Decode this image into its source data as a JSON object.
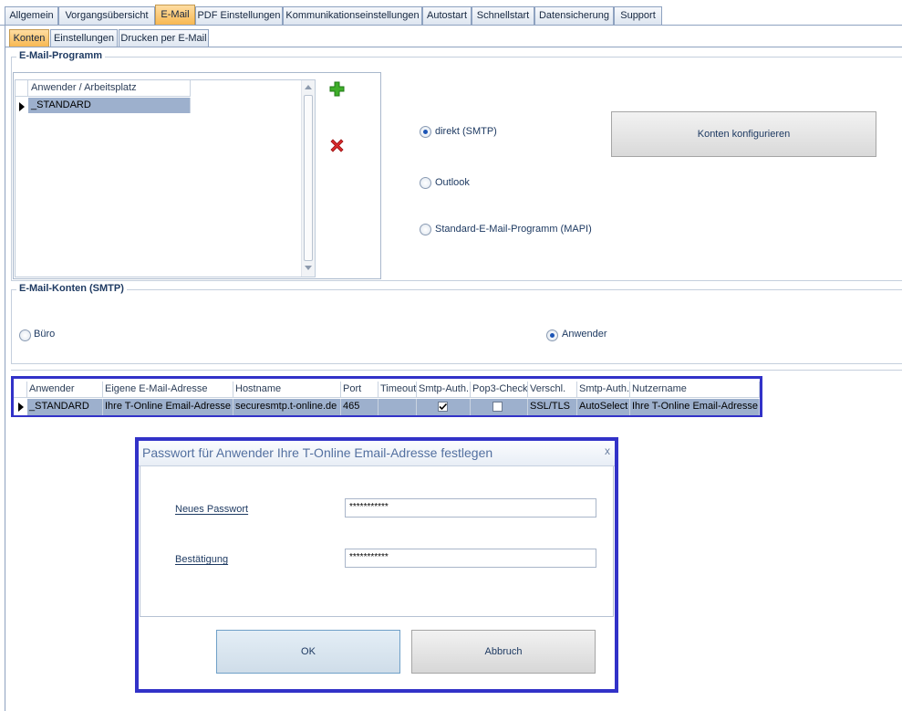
{
  "main_tabs": [
    "Allgemein",
    "Vorgangsübersicht",
    "E-Mail",
    "PDF Einstellungen",
    "Kommunikationseinstellungen",
    "Autostart",
    "Schnellstart",
    "Datensicherung",
    "Support"
  ],
  "sub_tabs": [
    "Konten",
    "Einstellungen",
    "Drucken per E-Mail"
  ],
  "email_program": {
    "title": "E-Mail-Programm",
    "list_header": "Anwender / Arbeitsplatz",
    "list_rows": [
      "_STANDARD"
    ],
    "add_icon": "plus-icon",
    "delete_icon": "x-icon",
    "radios": [
      {
        "label": "direkt (SMTP)",
        "checked": true
      },
      {
        "label": "Outlook",
        "checked": false
      },
      {
        "label": "Standard-E-Mail-Programm (MAPI)",
        "checked": false
      }
    ],
    "configure_button": "Konten konfigurieren"
  },
  "smtp_accounts": {
    "title": "E-Mail-Konten (SMTP)",
    "radios": [
      {
        "label": "Büro",
        "checked": false
      },
      {
        "label": "Anwender",
        "checked": true
      }
    ]
  },
  "grid": {
    "headers": [
      "Anwender",
      "Eigene E-Mail-Adresse",
      "Hostname",
      "Port",
      "Timeout",
      "Smtp-Auth.",
      "Pop3-Check",
      "Verschl.",
      "Smtp-Auth.",
      "Nutzername"
    ],
    "row": {
      "user": "_STANDARD",
      "email": "Ihre T-Online Email-Adresse",
      "host": "securesmtp.t-online.de",
      "port": "465",
      "timeout": "",
      "smtp_auth_checked": true,
      "pop3_checked": false,
      "encryption": "SSL/TLS",
      "smtp_auth_mode": "AutoSelect",
      "username": "Ihre T-Online Email-Adresse"
    }
  },
  "dialog": {
    "title": "Passwort für Anwender Ihre T-Online Email-Adresse festlegen",
    "close": "x",
    "new_password_label": "Neues Passwort",
    "new_password_value": "***********",
    "confirm_label": "Bestätigung",
    "confirm_value": "***********",
    "ok_button": "OK",
    "cancel_button": "Abbruch"
  },
  "colors": {
    "accent": "#3232c8",
    "active_tab": "#f7b64e",
    "selection": "#9db0cd"
  }
}
